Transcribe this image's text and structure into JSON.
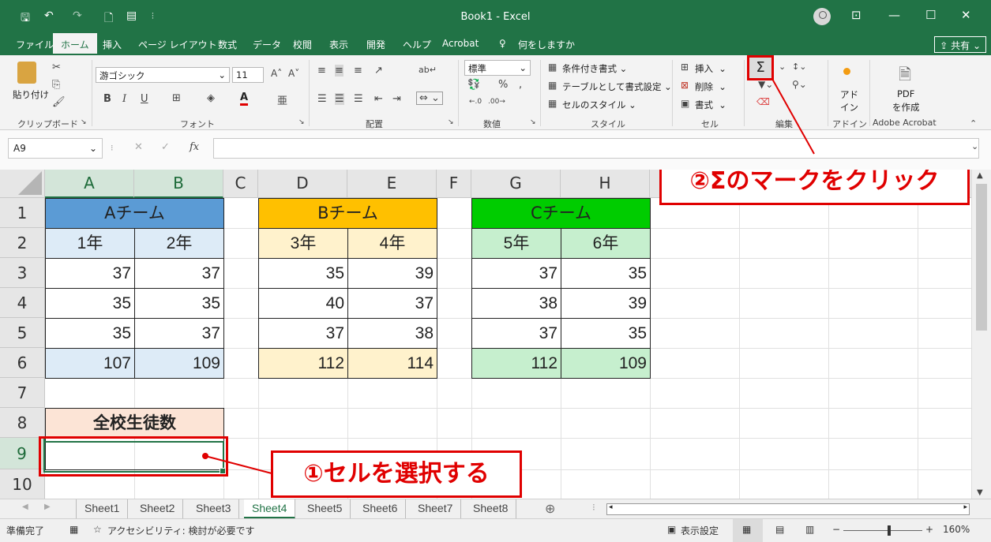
{
  "window": {
    "doc_title": "Book1 - Excel",
    "save_icon": "🖫",
    "undo_icon": "↶",
    "redo_icon": "↷",
    "new_icon": "🗋",
    "form_icon": "▤",
    "customize_icon": "⫶",
    "ribbon_display_icon": "⊡",
    "minimize_icon": "—",
    "maximize_icon": "☐",
    "close_icon": "✕"
  },
  "menu": {
    "tabs": [
      "ファイル",
      "ホーム",
      "挿入",
      "ページ レイアウト",
      "数式",
      "データ",
      "校閲",
      "表示",
      "開発",
      "ヘルプ",
      "Acrobat"
    ],
    "tell_me": "何をしますか",
    "share": "共有"
  },
  "ribbon": {
    "clipboard": {
      "paste": "貼り付け",
      "label": "クリップボード"
    },
    "font": {
      "name": "游ゴシック",
      "size": "11",
      "label": "フォント",
      "bold": "B",
      "italic": "I",
      "underline": "U",
      "font_color": "A"
    },
    "alignment": {
      "label": "配置"
    },
    "number": {
      "format": "標準",
      "percent": "%",
      "comma": ",",
      "label": "数値"
    },
    "styles": {
      "conditional": "条件付き書式",
      "as_table": "テーブルとして書式設定",
      "cell_styles": "セルのスタイル",
      "label": "スタイル"
    },
    "cells": {
      "insert": "挿入",
      "delete": "削除",
      "format": "書式",
      "label": "セル"
    },
    "editing": {
      "autosum": "Σ",
      "label": "編集"
    },
    "addins": {
      "line1": "アド",
      "line2": "イン",
      "label": "アドイン"
    },
    "acrobat": {
      "line1": "PDF",
      "line2": "を作成",
      "label": "Adobe Acrobat"
    }
  },
  "formula_bar": {
    "name_box": "A9",
    "cancel": "✕",
    "enter": "✓",
    "fx": "fx",
    "value": ""
  },
  "grid": {
    "columns": [
      "A",
      "B",
      "C",
      "D",
      "E",
      "F",
      "G",
      "H"
    ],
    "rows": [
      "1",
      "2",
      "3",
      "4",
      "5",
      "6",
      "7",
      "8",
      "9",
      "10"
    ],
    "team_a": {
      "title": "Aチーム",
      "g1": "1年",
      "g2": "2年",
      "v": [
        [
          "37",
          "37"
        ],
        [
          "35",
          "35"
        ],
        [
          "35",
          "37"
        ]
      ],
      "total": [
        "107",
        "109"
      ]
    },
    "team_b": {
      "title": "Bチーム",
      "g1": "3年",
      "g2": "4年",
      "v": [
        [
          "35",
          "39"
        ],
        [
          "40",
          "37"
        ],
        [
          "37",
          "38"
        ]
      ],
      "total": [
        "112",
        "114"
      ]
    },
    "team_c": {
      "title": "Cチーム",
      "g1": "5年",
      "g2": "6年",
      "v": [
        [
          "37",
          "35"
        ],
        [
          "38",
          "39"
        ],
        [
          "37",
          "35"
        ]
      ],
      "total": [
        "112",
        "109"
      ]
    },
    "summary_label": "全校生徒数"
  },
  "annotations": {
    "step1": "①セルを選択する",
    "step2": "②Σのマークをクリック"
  },
  "sheets": [
    "Sheet1",
    "Sheet2",
    "Sheet3",
    "Sheet4",
    "Sheet5",
    "Sheet6",
    "Sheet7",
    "Sheet8"
  ],
  "active_sheet": "Sheet4",
  "status": {
    "ready": "準備完了",
    "accessibility": "アクセシビリティ: 検討が必要です",
    "display_settings": "表示設定",
    "zoom": "160%"
  },
  "colors": {
    "excel_green": "#217346",
    "team_a_header": "#5b9bd5",
    "team_a_light": "#ddebf7",
    "team_b_header": "#ffc000",
    "team_b_light": "#fff2cc",
    "team_c_header": "#00cc00",
    "team_c_light": "#c6efce",
    "summary_fill": "#fce4d6",
    "annotation_red": "#e00000"
  }
}
